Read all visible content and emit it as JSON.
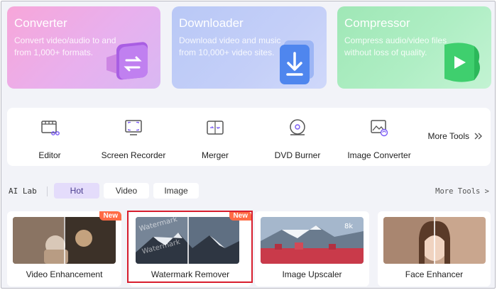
{
  "features": [
    {
      "title": "Converter",
      "desc": "Convert video/audio to and from 1,000+ formats."
    },
    {
      "title": "Downloader",
      "desc": "Download video and music from 10,000+ video sites."
    },
    {
      "title": "Compressor",
      "desc": "Compress audio/video files without loss of quality."
    }
  ],
  "tools": {
    "items": [
      {
        "label": "Editor",
        "icon": "editor-icon"
      },
      {
        "label": "Screen Recorder",
        "icon": "screen-recorder-icon"
      },
      {
        "label": "Merger",
        "icon": "merger-icon"
      },
      {
        "label": "DVD Burner",
        "icon": "dvd-burner-icon"
      },
      {
        "label": "Image Converter",
        "icon": "image-converter-icon"
      }
    ],
    "more_label": "More Tools",
    "more_icon": "double-chevron-right-icon"
  },
  "ailab": {
    "title": "AI Lab",
    "tabs": [
      {
        "label": "Hot",
        "active": true
      },
      {
        "label": "Video",
        "active": false
      },
      {
        "label": "Image",
        "active": false
      }
    ],
    "more_label": "More Tools >"
  },
  "cards": [
    {
      "label": "Video Enhancement",
      "badge": "New"
    },
    {
      "label": "Watermark Remover",
      "badge": "New",
      "thumb_text": "Watermark"
    },
    {
      "label": "Image Upscaler",
      "thumb_text": "8k"
    },
    {
      "label": "Face Enhancer"
    }
  ],
  "colors": {
    "highlight": "#d81e2e",
    "badge": "#ff6b45",
    "active_tab": "#e4dcfb"
  }
}
